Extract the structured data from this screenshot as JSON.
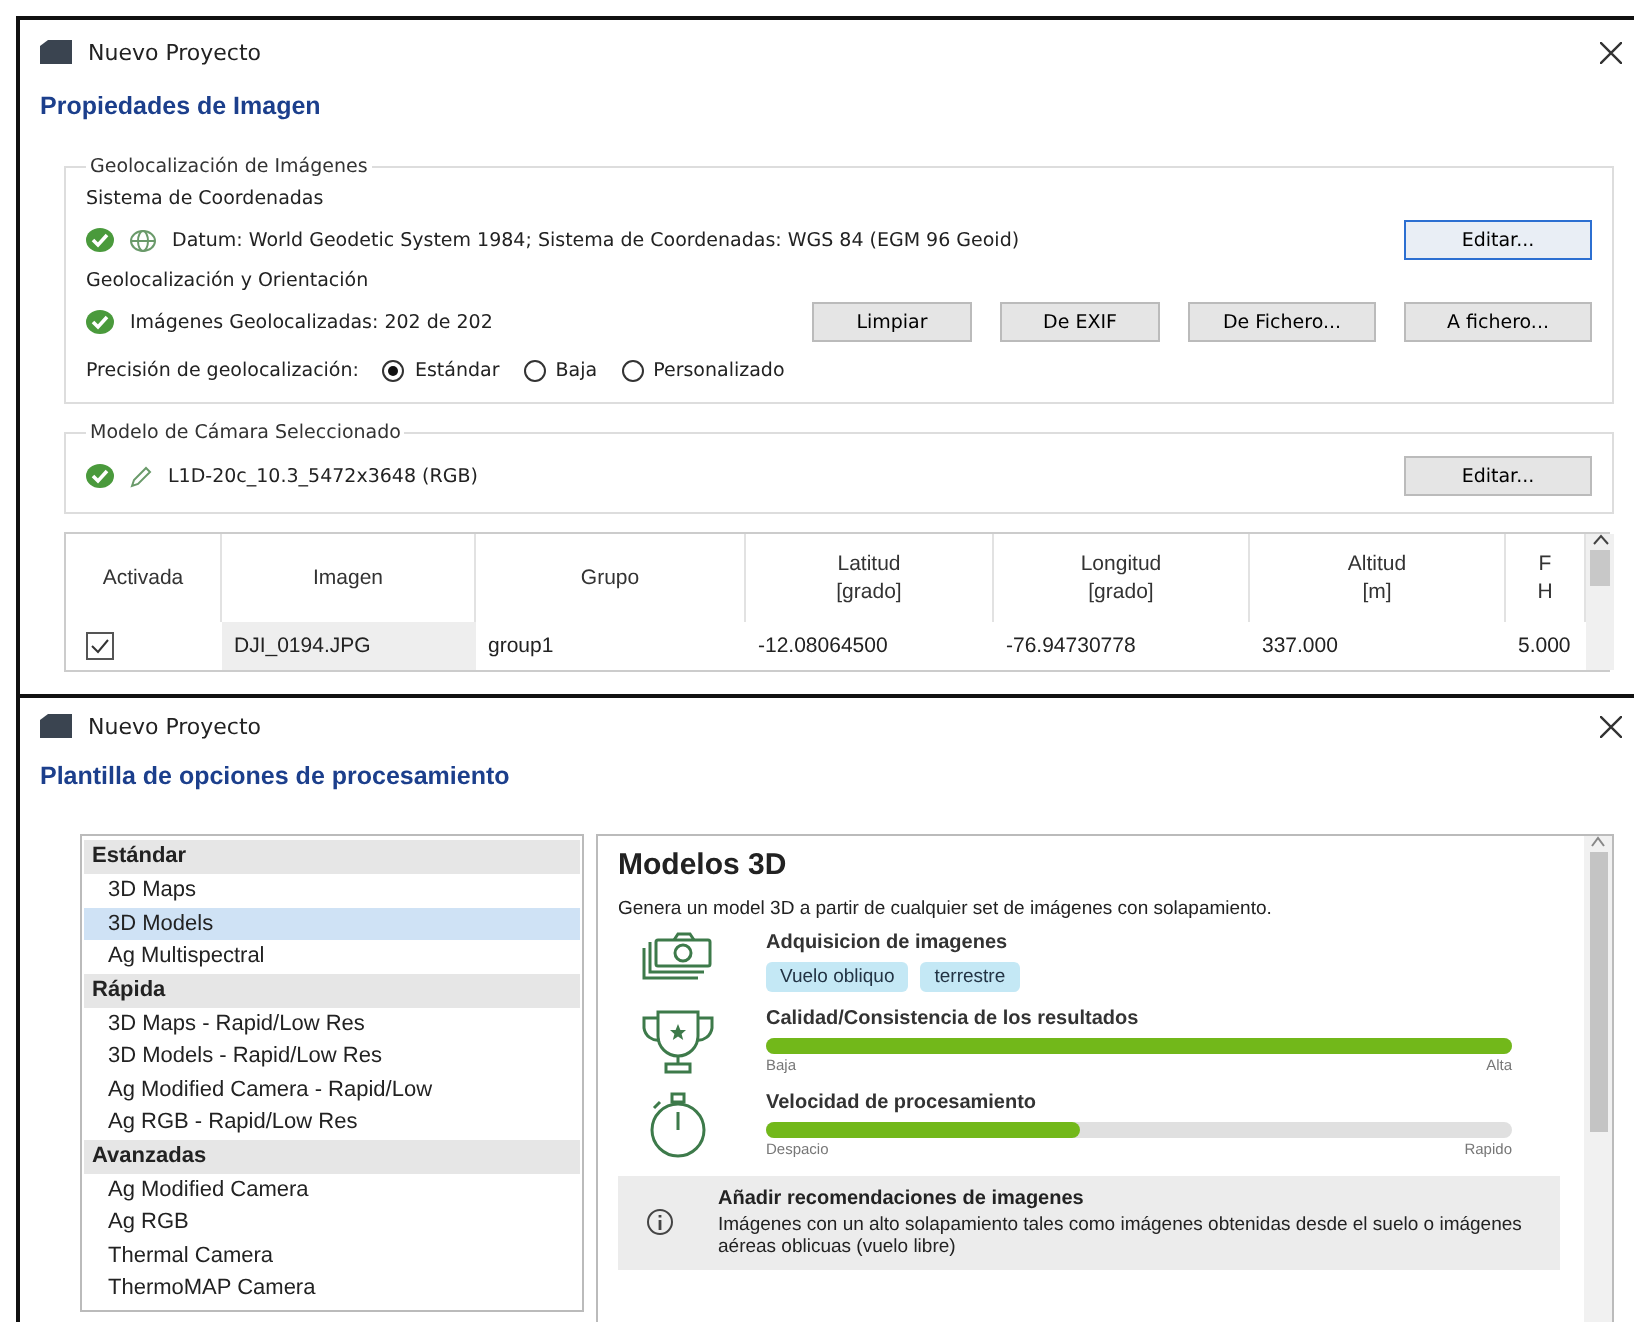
{
  "image_dialog": {
    "window": {
      "title": "Nuevo Proyecto"
    },
    "heading": "Propiedades de Imagen",
    "geolocation": {
      "title": "Geolocalización de Imágenes",
      "coordinate_system": {
        "label": "Sistema de Coordenadas",
        "ok": true,
        "value": "Datum: World Geodetic System 1984; Sistema de Coordenadas: WGS 84 (EGM 96 Geoid)",
        "button": {
          "label": "Editar...",
          "focused": true
        }
      },
      "orientation": {
        "label": "Geolocalización y Orientación",
        "ok": true,
        "value": "Imágenes Geolocalizadas: 202 de 202",
        "buttons": [
          "Limpiar",
          "De EXIF",
          "De Fichero...",
          "A fichero..."
        ]
      },
      "precision": {
        "label": "Precisión de geolocalización:",
        "options": [
          {
            "label": "Estándar",
            "selected": true
          },
          {
            "label": "Baja",
            "selected": false
          },
          {
            "label": "Personalizado",
            "selected": false
          }
        ]
      }
    },
    "camera": {
      "title": "Modelo de Cámara Seleccionado",
      "ok": true,
      "value": "L1D-20c_10.3_5472x3648 (RGB)",
      "button": {
        "label": "Editar...",
        "focused": false
      }
    },
    "table": {
      "columns": [
        {
          "lines": [
            "Activada"
          ]
        },
        {
          "lines": [
            "Imagen"
          ]
        },
        {
          "lines": [
            "Grupo"
          ]
        },
        {
          "lines": [
            "Latitud",
            "[grado]"
          ]
        },
        {
          "lines": [
            "Longitud",
            "[grado]"
          ]
        },
        {
          "lines": [
            "Altitud",
            "[m]"
          ]
        },
        {
          "lines": [
            "F",
            "H"
          ]
        }
      ],
      "rows": [
        {
          "checked": true,
          "cells": [
            "",
            "DJI_0194.JPG",
            "group1",
            "-12.08064500",
            "-76.94730778",
            "337.000",
            "5.000"
          ]
        }
      ]
    }
  },
  "template_dialog": {
    "window": {
      "title": "Nuevo Proyecto"
    },
    "heading": "Plantilla de opciones de procesamiento",
    "groups": [
      {
        "label": "Estándar",
        "items": [
          {
            "label": "3D Maps",
            "selected": false
          },
          {
            "label": "3D Models",
            "selected": true
          },
          {
            "label": "Ag Multispectral",
            "selected": false
          }
        ]
      },
      {
        "label": "Rápida",
        "items": [
          {
            "label": "3D Maps - Rapid/Low Res",
            "selected": false
          },
          {
            "label": "3D Models - Rapid/Low Res",
            "selected": false
          },
          {
            "label": "Ag Modified Camera - Rapid/Low",
            "selected": false
          },
          {
            "label": "Ag RGB - Rapid/Low Res",
            "selected": false
          }
        ]
      },
      {
        "label": "Avanzadas",
        "items": [
          {
            "label": "Ag Modified Camera",
            "selected": false
          },
          {
            "label": "Ag RGB",
            "selected": false
          },
          {
            "label": "Thermal Camera",
            "selected": false
          },
          {
            "label": "ThermoMAP Camera",
            "selected": false
          }
        ]
      }
    ],
    "detail": {
      "title": "Modelos 3D",
      "description": "Genera un model 3D a partir de cualquier set de imágenes con solapamiento.",
      "sections": [
        {
          "kind": "acquisition",
          "title": "Adquisicion de imagenes",
          "tags": [
            "Vuelo obliquo",
            "terrestre"
          ]
        },
        {
          "kind": "quality",
          "title": "Calidad/Consistencia de los resultados",
          "level": 1,
          "min_label": "Baja",
          "max_label": "Alta"
        },
        {
          "kind": "speed",
          "title": "Velocidad de procesamiento",
          "level": 0.42,
          "min_label": "Despacio",
          "max_label": "Rapido"
        }
      ],
      "note": {
        "title": "Añadir recomendaciones de imagenes",
        "text": "Imágenes con un alto solapamiento tales como imágenes obtenidas desde el suelo o imágenes aéreas oblicuas (vuelo libre)"
      }
    }
  }
}
